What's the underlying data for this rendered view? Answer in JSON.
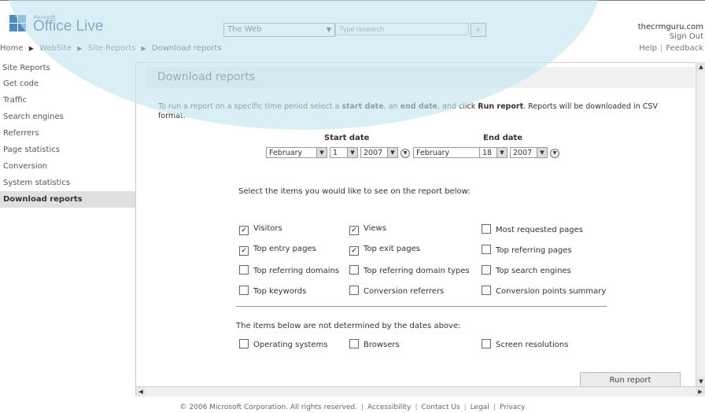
{
  "header": {
    "logo_small": "Microsoft",
    "logo_text": "Office Live",
    "search_scope": "The Web",
    "search_placeholder": "Type research",
    "user_domain": "thecrmguru.com",
    "sign_out": "Sign Out",
    "help": "Help",
    "feedback": "Feedback"
  },
  "breadcrumb": [
    "Home",
    "WebSite",
    "Site Reports",
    "Download reports"
  ],
  "left_nav": {
    "header": "Site Reports",
    "items": [
      "Get code",
      "Traffic",
      "Search engines",
      "Referrers",
      "Page statistics",
      "Conversion",
      "System statistics",
      "Download reports"
    ]
  },
  "main": {
    "title": "Download reports",
    "description_parts": [
      "To run a report on a specific time period select a ",
      "start date",
      ", an ",
      "end date",
      ", and click ",
      "Run report",
      ". Reports will be downloaded in CSV format."
    ],
    "start_label": "Start date",
    "end_label": "End date",
    "start_month": "February",
    "start_day": "1",
    "start_year": "2007",
    "end_month": "February",
    "end_day": "18",
    "end_year": "2007",
    "select_prompt": "Select the items you would like to see on the report below:",
    "items": [
      {
        "label": "Visitors",
        "checked": true
      },
      {
        "label": "Views",
        "checked": true
      },
      {
        "label": "Most requested pages",
        "checked": false
      },
      {
        "label": "Top entry pages",
        "checked": true
      },
      {
        "label": "Top exit pages",
        "checked": true
      },
      {
        "label": "Top referring pages",
        "checked": false
      },
      {
        "label": "Top referring domains",
        "checked": false
      },
      {
        "label": "Top referring domain types",
        "checked": false
      },
      {
        "label": "Top search engines",
        "checked": false
      },
      {
        "label": "Top keywords",
        "checked": false
      },
      {
        "label": "Conversion referrers",
        "checked": false
      },
      {
        "label": "Conversion points summary",
        "checked": false
      }
    ],
    "not_determined_text": "The items below are not determined by the dates above:",
    "extra_items": [
      {
        "label": "Operating systems",
        "checked": false
      },
      {
        "label": "Browsers",
        "checked": false
      },
      {
        "label": "Screen resolutions",
        "checked": false
      }
    ],
    "run_button": "Run report"
  },
  "footer": {
    "copyright": "© 2006 Microsoft Corporation. All rights reserved.",
    "links": [
      "Accessibility",
      "Contact Us",
      "Legal",
      "Privacy"
    ]
  }
}
